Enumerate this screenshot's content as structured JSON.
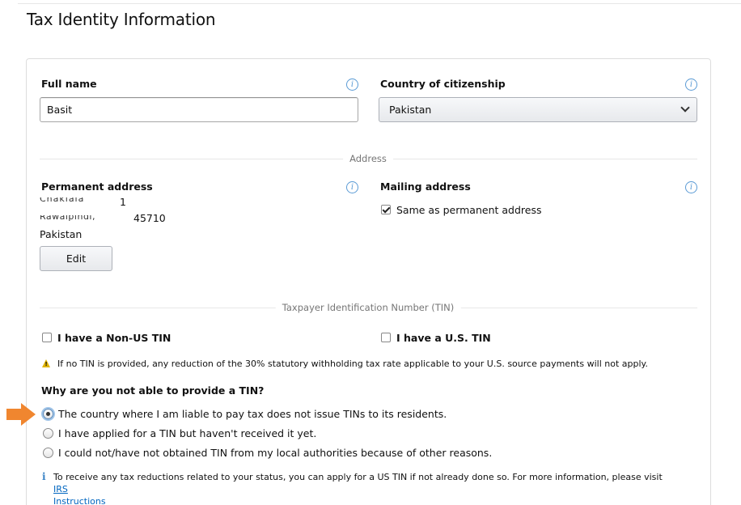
{
  "page": {
    "title": "Tax Identity Information"
  },
  "identity": {
    "full_name_label": "Full name",
    "full_name_value": "Basit",
    "citizenship_label": "Country of citizenship",
    "citizenship_value": "Pakistan"
  },
  "address": {
    "divider_label": "Address",
    "permanent_label": "Permanent address",
    "permanent_line1": "1",
    "permanent_line2": "45710",
    "permanent_country": "Pakistan",
    "edit_button": "Edit",
    "mailing_label": "Mailing address",
    "same_as_permanent": "Same as permanent address"
  },
  "tin": {
    "divider_label": "Taxpayer Identification Number (TIN)",
    "non_us_tin": "I have a Non-US TIN",
    "us_tin": "I have a U.S. TIN",
    "warning": "If no TIN is provided, any reduction of the 30% statutory withholding tax rate applicable to your U.S. source payments will not apply.",
    "question": "Why are you not able to provide a TIN?",
    "options": [
      "The country where I am liable to pay tax does not issue TINs to its residents.",
      "I have applied for a TIN but haven't received it yet.",
      "I could not/have not obtained TIN from my local authorities because of other reasons."
    ],
    "info_text": "To receive any tax reductions related to your status, you can apply for a US TIN if not already done so. For more information, please visit",
    "info_link_1": "IRS",
    "info_link_2": "Instructions"
  },
  "colors": {
    "accent_arrow": "#f0862f",
    "info_blue": "#5b9bd5",
    "link": "#0066c0",
    "warning": "#e0b400"
  }
}
